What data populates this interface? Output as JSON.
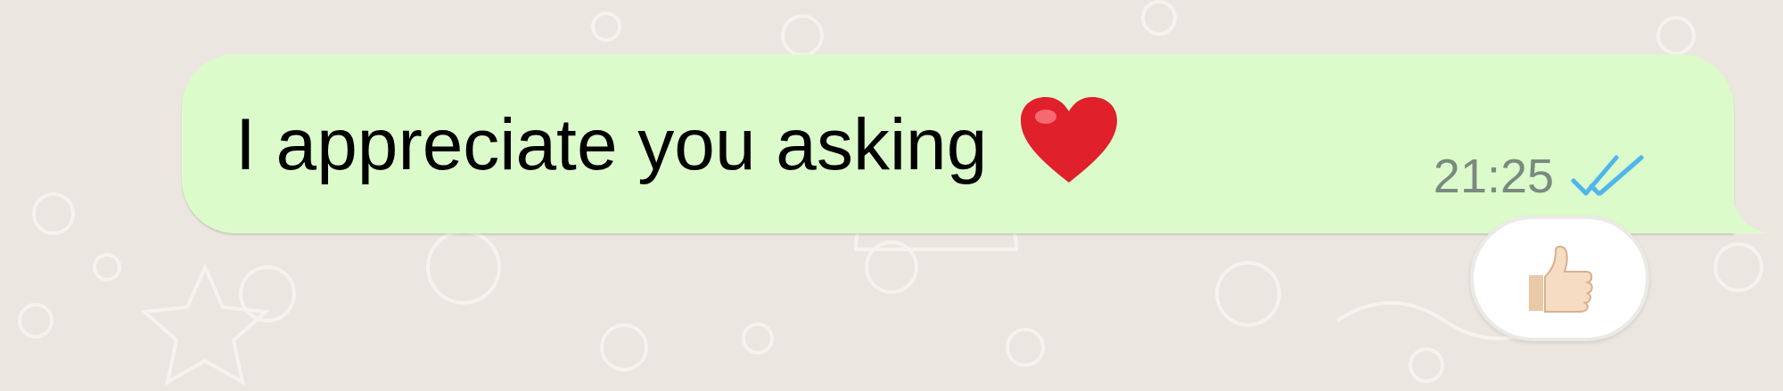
{
  "message": {
    "text": "I appreciate you asking",
    "time": "21:25",
    "read": true
  }
}
